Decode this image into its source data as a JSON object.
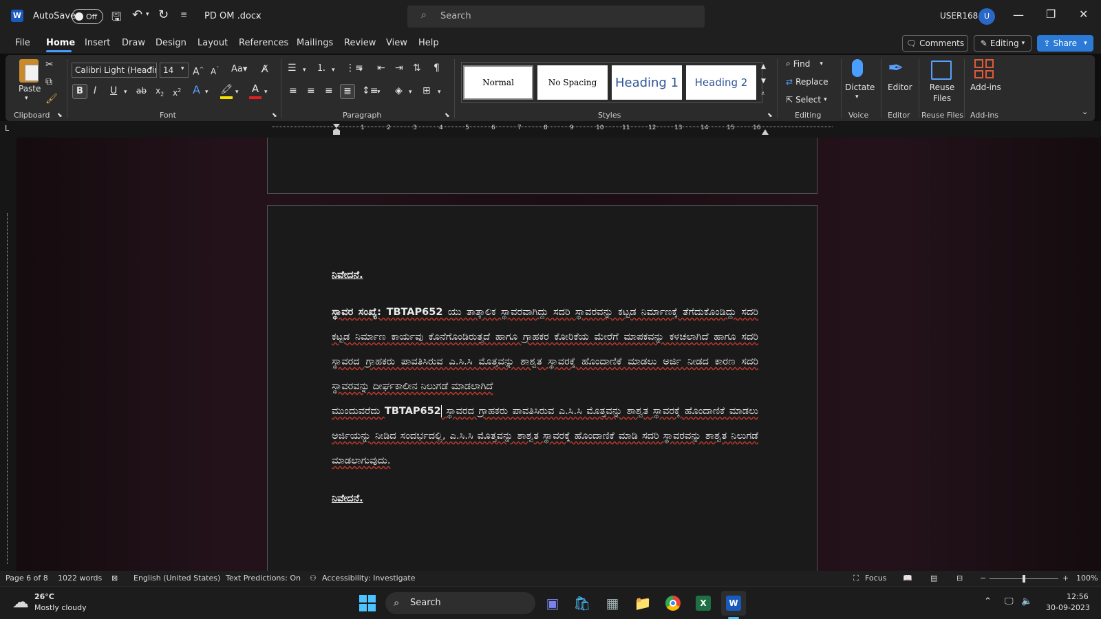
{
  "titlebar": {
    "autosave_label": "AutoSave",
    "autosave_state": "Off",
    "filename": "PD OM .docx",
    "search_placeholder": "Search",
    "user": "USER168",
    "avatar_initial": "U"
  },
  "tabs": [
    "File",
    "Home",
    "Insert",
    "Draw",
    "Design",
    "Layout",
    "References",
    "Mailings",
    "Review",
    "View",
    "Help"
  ],
  "right_actions": {
    "comments": "Comments",
    "editing": "Editing",
    "share": "Share"
  },
  "ribbon": {
    "paste_label": "Paste",
    "font_name": "Calibri Light (Headin",
    "font_size": "14",
    "styles": [
      "Normal",
      "No Spacing",
      "Heading 1",
      "Heading 2"
    ],
    "find": "Find",
    "replace": "Replace",
    "select": "Select",
    "dictate": "Dictate",
    "editor": "Editor",
    "reuse_files": "Reuse Files",
    "add_ins": "Add-ins",
    "groups": {
      "clipboard": "Clipboard",
      "font": "Font",
      "paragraph": "Paragraph",
      "styles": "Styles",
      "editing": "Editing",
      "voice": "Voice",
      "editor": "Editor",
      "reuse_files": "Reuse Files",
      "add_ins": "Add-ins"
    }
  },
  "ruler_numbers": [
    "1",
    "2",
    "3",
    "4",
    "5",
    "6",
    "7",
    "8",
    "9",
    "10",
    "11",
    "12",
    "13",
    "14",
    "15",
    "16"
  ],
  "document": {
    "heading1": "ನಿವೇದನೆ.",
    "para1_bold": "ಸ್ಥಾವರ ಸಂಖ್ಯೆ: TBTAP652",
    "para1_text": " ಯು ತಾತ್ಕಾಲಿಕ ಸ್ಥಾವರವಾಗಿದ್ದು ಸದರಿ ಸ್ಥಾವರವನ್ನು ಕಟ್ಟಡ ನಿರ್ಮಾಣಕ್ಕೆ ತೆಗೆದುಕೊಂಡಿದ್ದು ಸದರಿ ಕಟ್ಟಡ ನಿರ್ಮಾಣ ಕಾರ್ಯವು ಕೊನೆಗೊಂಡಿರುತ್ತದೆ ಹಾಗೂ ಗ್ರಾಹಕರ ಕೋರಿಕೆಯ ಮೇರೆಗೆ ಮಾಪಕವನ್ನು ಕಳಚಲಾಗಿದೆ ಹಾಗೂ ಸದರಿ ಸ್ಥಾವರದ ಗ್ರಾಹಕರು ಪಾವತಿಸಿರುವ ಎ.ಸಿ.ಸಿ ಮೊತ್ತವನ್ನು ಶಾಶ್ವತ ಸ್ಥಾವರಕ್ಕೆ ಹೊಂದಾಣಿಕೆ ಮಾಡಲು ಅರ್ಜಿ ನೀಡದ ಕಾರಣ ಸದರಿ ಸ್ಥಾವರವನ್ನು ದೀರ್ಘಕಾಲೀನ ನಿಲುಗಡೆ ಮಾಡಲಾಗಿದೆ",
    "para2_pre": "ಮುಂದುವರೆದು ",
    "para2_bold": "TBTAP652",
    "para2_text": " ಸ್ಥಾವರದ ಗ್ರಾಹಕರು ಪಾವತಿಸಿರುವ ಎ.ಸಿ.ಸಿ ಮೊತ್ತವನ್ನು ಶಾಶ್ವತ ಸ್ಥಾವರಕ್ಕೆ ಹೊಂದಾಣಿಕೆ ಮಾಡಲು ಅರ್ಜಿಯನ್ನು ನೀಡಿದ ಸಂದರ್ಭದಲ್ಲಿ, ಎ.ಸಿ.ಸಿ ಮೊತ್ತವನ್ನು ಶಾಶ್ವತ ಸ್ಥಾವರಕ್ಕೆ ಹೊಂದಾಣಿಕೆ ಮಾಡಿ ಸದರಿ ಸ್ಥಾವರವನ್ನು ಶಾಶ್ವತ ನಿಲುಗಡೆ ಮಾಡಲಾಗುವುದು.",
    "heading2": "ನಿವೇದನೆ."
  },
  "status": {
    "page": "Page 6 of 8",
    "words": "1022 words",
    "language": "English (United States)",
    "predictions": "Text Predictions: On",
    "accessibility": "Accessibility: Investigate",
    "focus": "Focus",
    "zoom": "100%"
  },
  "taskbar": {
    "temp": "26°C",
    "weather": "Mostly cloudy",
    "search": "Search",
    "time": "12:56",
    "date": "30-09-2023"
  },
  "colors": {
    "accent": "#4a9eff",
    "word_blue": "#185abd",
    "share_blue": "#2a7ad6"
  }
}
